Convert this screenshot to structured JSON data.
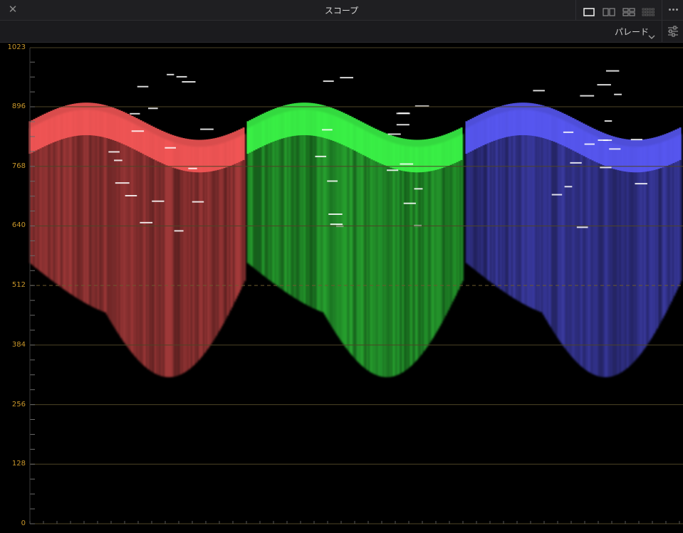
{
  "window": {
    "title": "スコープ",
    "close_icon": "close-icon",
    "layouts": [
      "layout-single-icon",
      "layout-dual-icon",
      "layout-quad-icon",
      "layout-multi-icon"
    ],
    "more_icon": "more-dots-icon"
  },
  "toolbar": {
    "mode_label": "パレード",
    "mode_chevron": "chevron-down-icon",
    "settings_icon": "sliders-icon"
  },
  "scope": {
    "type": "RGB parade",
    "y_ticks": [
      "1023",
      "896",
      "768",
      "640",
      "512",
      "384",
      "256",
      "128",
      "0"
    ],
    "y_tick_values": [
      1023,
      896,
      768,
      640,
      512,
      384,
      256,
      128,
      0
    ],
    "y_range": [
      0,
      1023
    ],
    "dashed_line_value": 512,
    "channels": [
      {
        "name": "R",
        "color": "#ff5a5a"
      },
      {
        "name": "G",
        "color": "#3dff4a"
      },
      {
        "name": "B",
        "color": "#5c5cff"
      }
    ],
    "accent_color": "#c8962a"
  }
}
